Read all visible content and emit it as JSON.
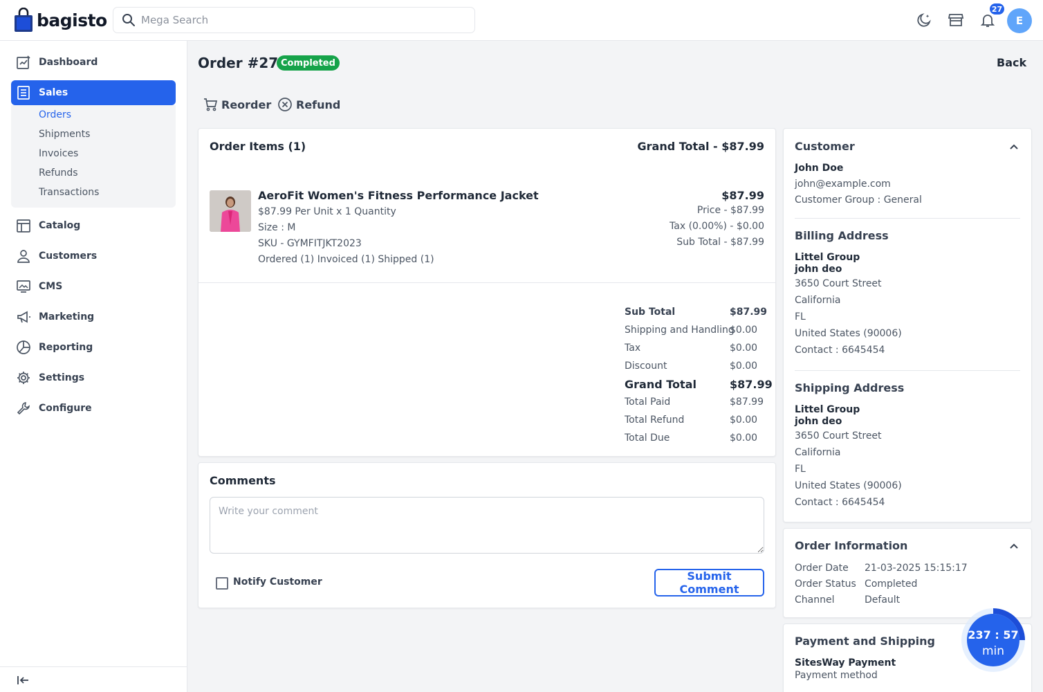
{
  "brand": {
    "name": "bagisto"
  },
  "search": {
    "placeholder": "Mega Search"
  },
  "header": {
    "notification_count": "27",
    "avatar_initial": "E"
  },
  "sidebar": {
    "items": [
      {
        "label": "Dashboard"
      },
      {
        "label": "Sales"
      },
      {
        "label": "Catalog"
      },
      {
        "label": "Customers"
      },
      {
        "label": "CMS"
      },
      {
        "label": "Marketing"
      },
      {
        "label": "Reporting"
      },
      {
        "label": "Settings"
      },
      {
        "label": "Configure"
      }
    ],
    "sales_sub": [
      "Orders",
      "Shipments",
      "Invoices",
      "Refunds",
      "Transactions"
    ]
  },
  "order": {
    "title": "Order #27",
    "status": "Completed",
    "back": "Back",
    "actions": {
      "reorder": "Reorder",
      "refund": "Refund"
    }
  },
  "items_card": {
    "title": "Order Items (1)",
    "grand_total_heading": "Grand Total - $87.99",
    "item": {
      "name": "AeroFit Women's Fitness Performance Jacket",
      "unit_line": "$87.99 Per Unit x 1 Quantity",
      "size": "Size : M",
      "sku": "SKU - GYMFITJKT2023",
      "status_line": "Ordered (1) Invoiced (1) Shipped (1)",
      "total": "$87.99",
      "price": "Price - $87.99",
      "tax": "Tax (0.00%) - $0.00",
      "sub_total": "Sub Total - $87.99"
    },
    "totals": [
      {
        "label": "Sub Total",
        "value": "$87.99"
      },
      {
        "label": "Shipping and Handling",
        "value": "$0.00"
      },
      {
        "label": "Tax",
        "value": "$0.00"
      },
      {
        "label": "Discount",
        "value": "$0.00"
      },
      {
        "label": "Grand Total",
        "value": "$87.99"
      },
      {
        "label": "Total Paid",
        "value": "$87.99"
      },
      {
        "label": "Total Refund",
        "value": "$0.00"
      },
      {
        "label": "Total Due",
        "value": "$0.00"
      }
    ]
  },
  "comments": {
    "title": "Comments",
    "placeholder": "Write your comment",
    "notify_label": "Notify Customer",
    "submit_label": "Submit Comment"
  },
  "customer": {
    "title": "Customer",
    "name": "John Doe",
    "email": "john@example.com",
    "group": "Customer Group : General"
  },
  "billing": {
    "title": "Billing Address",
    "company": "Littel Group",
    "name": "john deo",
    "street": "3650 Court Street",
    "city": "California",
    "state": "FL",
    "country": "United States (90006)",
    "contact": "Contact : 6645454"
  },
  "shipping": {
    "title": "Shipping Address",
    "company": "Littel Group",
    "name": "john deo",
    "street": "3650 Court Street",
    "city": "California",
    "state": "FL",
    "country": "United States (90006)",
    "contact": "Contact : 6645454"
  },
  "order_info": {
    "title": "Order Information",
    "rows": [
      {
        "label": "Order Date",
        "value": "21-03-2025 15:15:17"
      },
      {
        "label": "Order Status",
        "value": "Completed"
      },
      {
        "label": "Channel",
        "value": "Default"
      }
    ]
  },
  "payment": {
    "title": "Payment and Shipping",
    "method_name": "SitesWay Payment",
    "method_label": "Payment method"
  },
  "timer": {
    "time": "237 : 57",
    "unit": "min"
  },
  "colors": {
    "accent": "#2563eb",
    "success": "#16a34a"
  }
}
